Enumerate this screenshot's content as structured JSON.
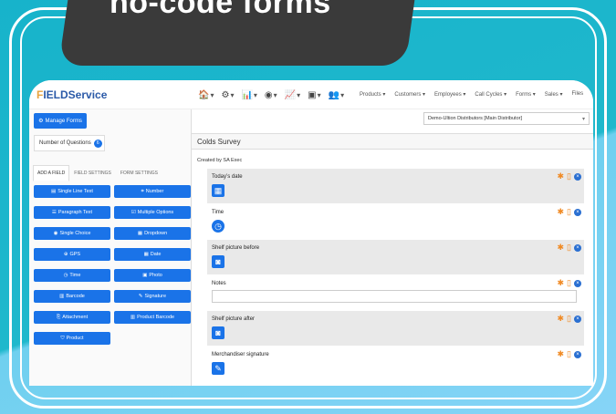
{
  "banner": {
    "title": "no-code forms"
  },
  "app": {
    "logo": {
      "prefix": "F",
      "rest": "IELDService"
    },
    "nav_icons": [
      {
        "icon": "home-icon",
        "glyph": "🏠"
      },
      {
        "icon": "settings-icon",
        "glyph": "⚙"
      },
      {
        "icon": "chart-icon",
        "glyph": "📊"
      },
      {
        "icon": "globe-icon",
        "glyph": "◉"
      },
      {
        "icon": "bar-chart-icon",
        "glyph": "📈"
      },
      {
        "icon": "document-icon",
        "glyph": "▣"
      },
      {
        "icon": "users-icon",
        "glyph": "👥"
      }
    ],
    "nav_menus": [
      "Products ▾",
      "Customers ▾",
      "Employees ▾",
      "Call Cycles ▾",
      "Forms ▾",
      "Sales ▾",
      "Files"
    ],
    "manage_forms": "Manage Forms",
    "num_questions_label": "Number of Questions",
    "num_questions_count": "6",
    "tabs": [
      "ADD A FIELD",
      "FIELD SETTINGS",
      "FORM SETTINGS"
    ],
    "field_buttons": [
      {
        "label": "Single Line Text",
        "icon": "▤"
      },
      {
        "label": "Number",
        "icon": "⌗"
      },
      {
        "label": "Paragraph Text",
        "icon": "☰"
      },
      {
        "label": "Multiple Options",
        "icon": "☑"
      },
      {
        "label": "Single Choice",
        "icon": "◉"
      },
      {
        "label": "Dropdown",
        "icon": "▦"
      },
      {
        "label": "GPS",
        "icon": "⊕"
      },
      {
        "label": "Date",
        "icon": "▦"
      },
      {
        "label": "Time",
        "icon": "◷"
      },
      {
        "label": "Photo",
        "icon": "▣"
      },
      {
        "label": "Barcode",
        "icon": "▥"
      },
      {
        "label": "Signature",
        "icon": "✎"
      },
      {
        "label": "Attachment",
        "icon": "⎘"
      },
      {
        "label": "Product Barcode",
        "icon": "▥"
      },
      {
        "label": "Product",
        "icon": "⛉"
      }
    ],
    "store_select": "Demo-Ultion Distributors [Main Distributor]",
    "survey_title": "Colds Survey",
    "created_by": "Created by SA Exec",
    "questions": [
      {
        "label": "Today’s date",
        "icon": "calendar-icon",
        "glyph": "▦"
      },
      {
        "label": "Time",
        "icon": "clock-icon",
        "glyph": "◷"
      },
      {
        "label": "Shelf picture before",
        "icon": "camera-icon",
        "glyph": "◙"
      },
      {
        "label": "Notes",
        "icon": "",
        "glyph": ""
      },
      {
        "label": "Shelf picture after",
        "icon": "camera-icon",
        "glyph": "◙"
      },
      {
        "label": "Merchandiser signature",
        "icon": "pen-icon",
        "glyph": "✎"
      }
    ]
  },
  "colors": {
    "primary": "#1a73e8",
    "accent": "#f08a24",
    "banner": "#3a3a3a",
    "bg": "#1fb8cc"
  }
}
